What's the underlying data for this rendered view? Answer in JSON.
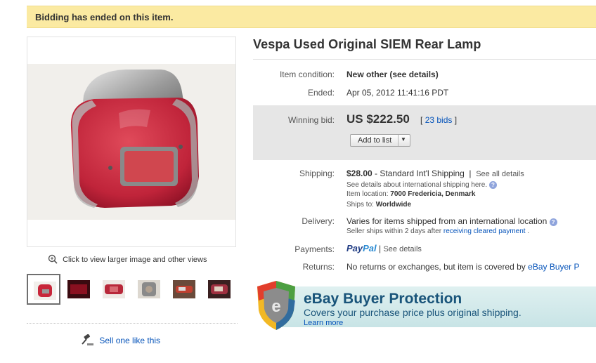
{
  "banner": {
    "text": "Bidding has ended on this item."
  },
  "gallery": {
    "zoom_text": "Click to view larger image and other views",
    "sell_text": "Sell one like this"
  },
  "item": {
    "title": "Vespa Used Original SIEM Rear Lamp",
    "condition_label": "Item condition:",
    "condition_value": "New other (see details)",
    "ended_label": "Ended:",
    "ended_value": "Apr 05, 2012 11:41:16 PDT"
  },
  "bid": {
    "label": "Winning bid:",
    "price": "US $222.50",
    "bids_open": "[",
    "bids_link": "23 bids",
    "bids_close": "]",
    "add_to_list": "Add to list"
  },
  "shipping": {
    "label": "Shipping:",
    "cost": "$28.00",
    "method": " - Standard Int'l Shipping",
    "pipe": "|",
    "see_all": "See all details",
    "international_note": "See details about international shipping here.",
    "location_label": "Item location:",
    "location_value": "7000 Fredericia, Denmark",
    "ships_to_label": "Ships to:",
    "ships_to_value": "Worldwide"
  },
  "delivery": {
    "label": "Delivery:",
    "value": "Varies for items shipped from an international location",
    "sub_before": "Seller ships within 2 days after",
    "sub_link": "receiving cleared payment",
    "sub_after": "."
  },
  "payments": {
    "label": "Payments:",
    "paypal_a": "Pay",
    "paypal_b": "Pal",
    "pipe": "|",
    "see_details": "See details"
  },
  "returns": {
    "label": "Returns:",
    "text": "No returns or exchanges, but item is covered by",
    "link": "eBay Buyer P"
  },
  "buyer_protection": {
    "title": "eBay Buyer Protection",
    "subtitle": "Covers your purchase price plus original shipping.",
    "learn_more": "Learn more"
  },
  "colors": {
    "banner_bg": "#fbeaa2",
    "link": "#0654ba",
    "bid_box_bg": "#e6e6e6",
    "lamp_red": "#c8263a",
    "ebp_text": "#19547a"
  },
  "icons": [
    "magnifier-icon",
    "gavel-icon",
    "help-icon",
    "dropdown-arrow-icon",
    "shield-icon"
  ]
}
